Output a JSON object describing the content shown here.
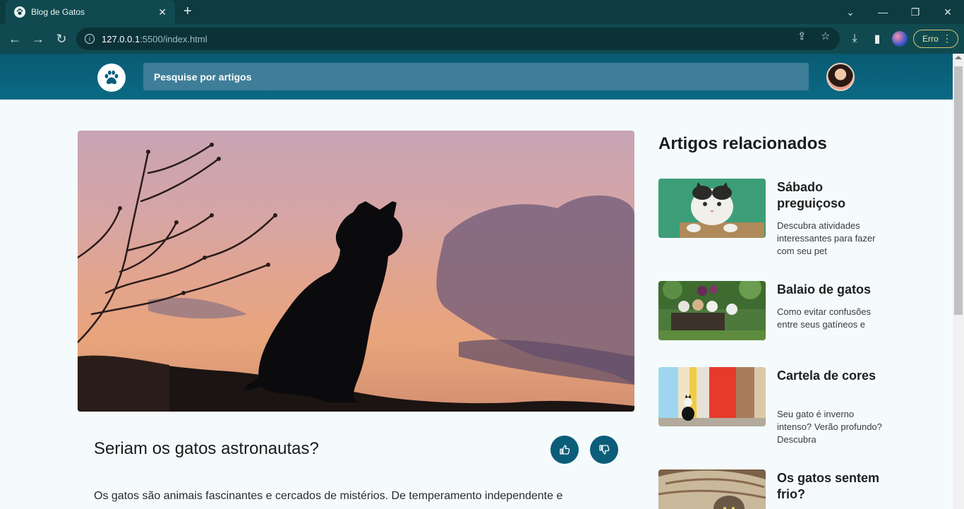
{
  "browser": {
    "tab_title": "Blog de Gatos",
    "url_host": "127.0.0.1",
    "url_path": ":5500/index.html",
    "profile_status": "Erro"
  },
  "header": {
    "search_placeholder": "Pesquise por artigos"
  },
  "article": {
    "title": "Seriam os gatos astronautas?",
    "body": "Os gatos são animais fascinantes e cercados de mistérios. De temperamento independente e"
  },
  "sidebar": {
    "title": "Artigos relacionados",
    "cards": [
      {
        "title": "Sábado preguiçoso",
        "desc": "Descubra atividades interessantes para fazer com seu pet"
      },
      {
        "title": "Balaio de gatos",
        "desc": "Como evitar confusões entre seus gatíneos e"
      },
      {
        "title": "Cartela de cores",
        "desc": "Seu gato é inverno intenso? Verão profundo? Descubra"
      },
      {
        "title": "Os gatos sentem frio?",
        "desc": ""
      }
    ]
  },
  "colors": {
    "header": "#0b6a85",
    "search": "#3e7e98",
    "vote_button": "#0b5d7a",
    "page_bg": "#f5fbfd"
  }
}
